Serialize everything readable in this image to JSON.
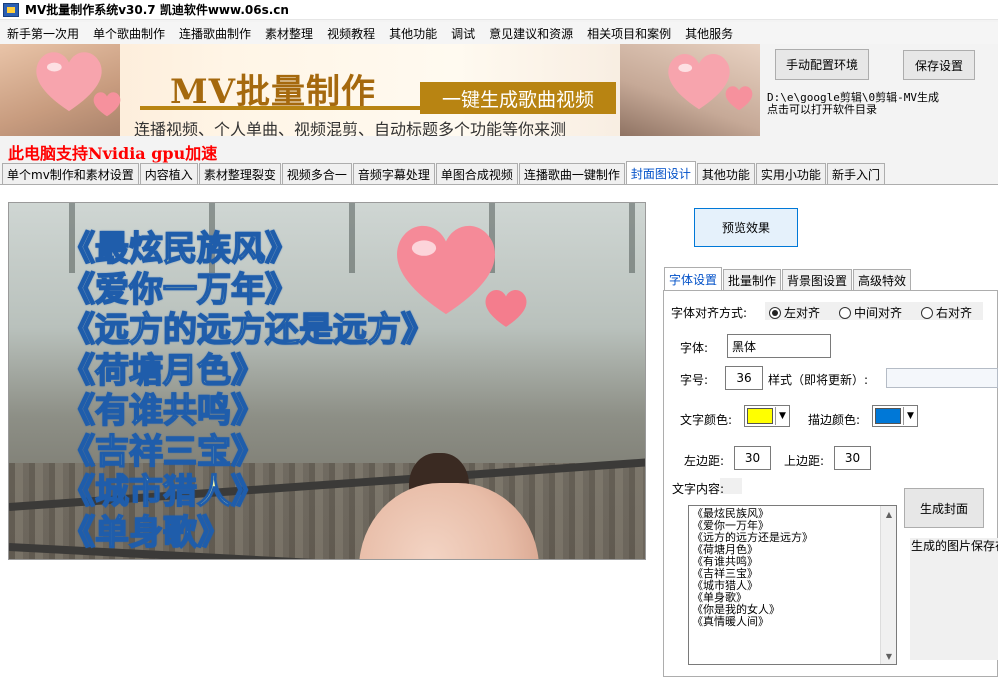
{
  "window": {
    "title": "MV批量制作系统v30.7    凯迪软件www.06s.cn"
  },
  "menubar": {
    "items": [
      "新手第一次用",
      "单个歌曲制作",
      "连播歌曲制作",
      "素材整理",
      "视频教程",
      "其他功能",
      "调试",
      "意见建议和资源",
      "相关项目和案例",
      "其他服务"
    ]
  },
  "banner": {
    "title": "MV批量制作",
    "slogan": "一键生成歌曲视频",
    "subtitle": "连播视频、个人单曲、视频混剪、自动标题多个功能等你来测"
  },
  "header_buttons": {
    "config_env": "手动配置环境",
    "save_settings": "保存设置"
  },
  "path_info": {
    "path": "D:\\e\\google剪辑\\0剪辑-MV生成",
    "hint": "点击可以打开软件目录"
  },
  "gpu_notice": "此电脑支持Nvidia gpu加速",
  "tabs": {
    "items": [
      "单个mv制作和素材设置",
      "内容植入",
      "素材整理裂变",
      "视频多合一",
      "音频字幕处理",
      "单图合成视频",
      "连播歌曲一键制作",
      "封面图设计",
      "其他功能",
      "实用小功能",
      "新手入门"
    ],
    "active": 7
  },
  "preview": {
    "cover_lines": [
      "《最炫民族风》",
      "《爱你一万年》",
      "《远方的远方还是远方》",
      "《荷塘月色》",
      "《有谁共鸣》",
      "《吉祥三宝》",
      "《城市猎人》",
      "《单身歌》"
    ],
    "button": "预览效果"
  },
  "subtabs": {
    "items": [
      "字体设置",
      "批量制作",
      "背景图设置",
      "高级特效"
    ],
    "active": 0
  },
  "font_settings": {
    "align_label": "字体对齐方式:",
    "align_options": [
      "左对齐",
      "中间对齐",
      "右对齐"
    ],
    "align_selected": 0,
    "font_label": "字体:",
    "font_value": "黑体",
    "size_label": "字号:",
    "size_value": "36",
    "style_label": "样式（即将更新）:",
    "style_value": "",
    "text_color_label": "文字颜色:",
    "text_color": "#ffff00",
    "stroke_color_label": "描边颜色:",
    "stroke_color": "#0078d7",
    "left_margin_label": "左边距:",
    "left_margin_value": "30",
    "top_margin_label": "上边距:",
    "top_margin_value": "30",
    "content_label": "文字内容:",
    "content_lines": [
      "《最炫民族风》",
      "《爱你一万年》",
      "《远方的远方还是远方》",
      "《荷塘月色》",
      "《有谁共鸣》",
      "《吉祥三宝》",
      "《城市猎人》",
      "《单身歌》",
      "《你是我的女人》",
      "《真情暖人间》"
    ],
    "generate_button": "生成封面",
    "result_text": "生成的图片保存在目录"
  },
  "icons": {
    "app": "app-icon",
    "scroll_up": "scroll-up-arrow-icon",
    "scroll_down": "scroll-down-arrow-icon",
    "dropdown": "dropdown-arrow-icon",
    "heart": "heart-icon"
  }
}
